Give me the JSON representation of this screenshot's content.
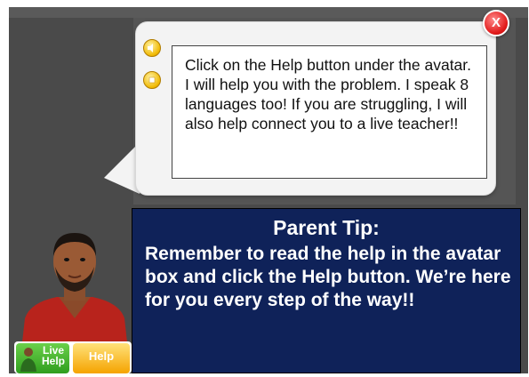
{
  "dialog": {
    "message": "Click on the Help button under the avatar. I will help you with the problem. I speak 8 languages too! If you are struggling, I will also help connect you to a live teacher!!",
    "close_label": "X",
    "side_buttons": [
      "speaker-icon",
      "stop-icon"
    ]
  },
  "tip": {
    "title": "Parent Tip:",
    "body": "Remember to read the help in the avatar box and click the Help button.  We’re here for you every step of the way!!"
  },
  "bottom_bar": {
    "live_help_label": "Live Help",
    "help_label": "Help"
  },
  "colors": {
    "tip_background": "#0f2259",
    "close_button": "#e21b1b",
    "live_button": "#3aa62a",
    "help_button": "#f5a300"
  }
}
